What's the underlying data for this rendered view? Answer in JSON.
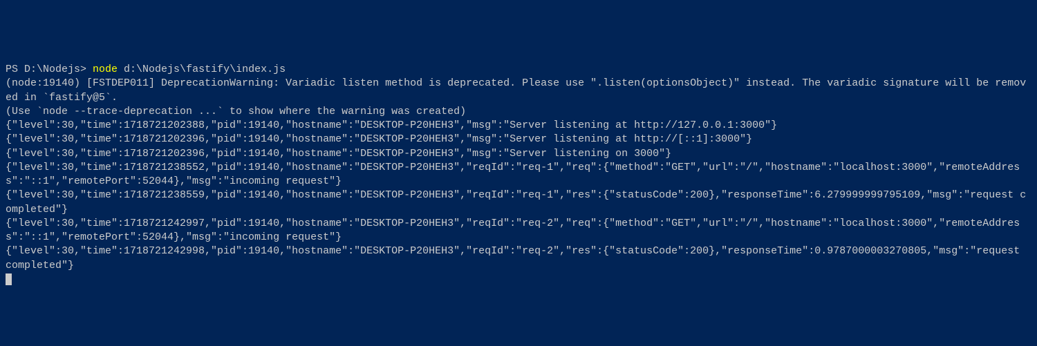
{
  "prompt": "PS D:\\Nodejs> ",
  "command": "node",
  "args": " d:\\Nodejs\\fastify\\index.js",
  "lines": {
    "l1": "(node:19140) [FSTDEP011] DeprecationWarning: Variadic listen method is deprecated. Please use \".listen(optionsObject)\" instead. The variadic signature will be removed in `fastify@5`.",
    "l2": "(Use `node --trace-deprecation ...` to show where the warning was created)",
    "l3": "{\"level\":30,\"time\":1718721202388,\"pid\":19140,\"hostname\":\"DESKTOP-P20HEH3\",\"msg\":\"Server listening at http://127.0.0.1:3000\"}",
    "l4": "{\"level\":30,\"time\":1718721202396,\"pid\":19140,\"hostname\":\"DESKTOP-P20HEH3\",\"msg\":\"Server listening at http://[::1]:3000\"}",
    "l5": "{\"level\":30,\"time\":1718721202396,\"pid\":19140,\"hostname\":\"DESKTOP-P20HEH3\",\"msg\":\"Server listening on 3000\"}",
    "l6": "{\"level\":30,\"time\":1718721238552,\"pid\":19140,\"hostname\":\"DESKTOP-P20HEH3\",\"reqId\":\"req-1\",\"req\":{\"method\":\"GET\",\"url\":\"/\",\"hostname\":\"localhost:3000\",\"remoteAddress\":\"::1\",\"remotePort\":52044},\"msg\":\"incoming request\"}",
    "l7": "{\"level\":30,\"time\":1718721238559,\"pid\":19140,\"hostname\":\"DESKTOP-P20HEH3\",\"reqId\":\"req-1\",\"res\":{\"statusCode\":200},\"responseTime\":6.279999999795109,\"msg\":\"request completed\"}",
    "l8": "{\"level\":30,\"time\":1718721242997,\"pid\":19140,\"hostname\":\"DESKTOP-P20HEH3\",\"reqId\":\"req-2\",\"req\":{\"method\":\"GET\",\"url\":\"/\",\"hostname\":\"localhost:3000\",\"remoteAddress\":\"::1\",\"remotePort\":52044},\"msg\":\"incoming request\"}",
    "l9": "{\"level\":30,\"time\":1718721242998,\"pid\":19140,\"hostname\":\"DESKTOP-P20HEH3\",\"reqId\":\"req-2\",\"res\":{\"statusCode\":200},\"responseTime\":0.9787000003270805,\"msg\":\"request completed\"}"
  }
}
